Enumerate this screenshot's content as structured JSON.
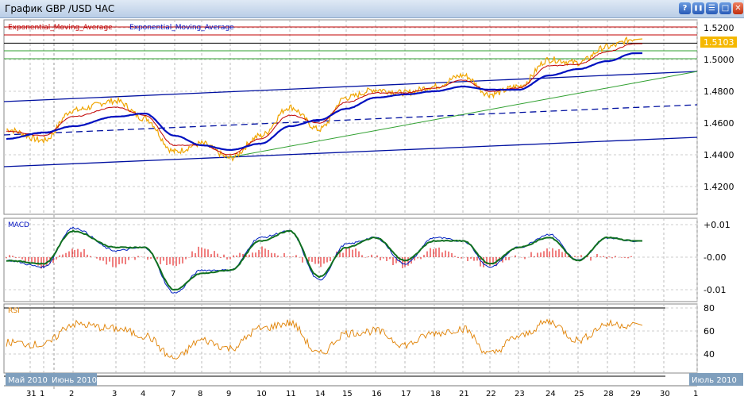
{
  "window": {
    "title": "График GBP /USD  ЧАС",
    "buttons": [
      "?",
      "❚❚",
      "☰",
      "□",
      "✕"
    ]
  },
  "colors": {
    "price": "#f0a500",
    "ema_fast": "#c00000",
    "ema_slow": "#0010c0",
    "macd": "#0020c0",
    "signal": "#107020",
    "hist": "#e00000",
    "rsi": "#e08000"
  },
  "chart_data": [
    {
      "type": "line",
      "title": "GBP/USD",
      "legend": [
        "Exponential_Moving_Average",
        "Exponential_Moving_Average"
      ],
      "ylim": [
        1.41,
        1.525
      ],
      "yticks": [
        "1.5200",
        "1.5000",
        "1.4800",
        "1.4600",
        "1.4400",
        "1.4200"
      ],
      "ytick_values": [
        1.52,
        1.5,
        1.48,
        1.46,
        1.44,
        1.42
      ],
      "last_price": "1.5103",
      "categories": [
        "31",
        "1",
        "2",
        "3",
        "4",
        "7",
        "8",
        "9",
        "10",
        "11",
        "14",
        "15",
        "16",
        "17",
        "18",
        "21",
        "22",
        "23",
        "24",
        "25",
        "28",
        "29"
      ],
      "series": [
        {
          "name": "price",
          "values": [
            1.456,
            1.449,
            1.468,
            1.474,
            1.463,
            1.442,
            1.447,
            1.438,
            1.452,
            1.47,
            1.456,
            1.476,
            1.481,
            1.479,
            1.483,
            1.49,
            1.478,
            1.483,
            1.5,
            1.498,
            1.508,
            1.513
          ]
        },
        {
          "name": "ema_fast",
          "values": [
            1.455,
            1.452,
            1.464,
            1.47,
            1.465,
            1.446,
            1.446,
            1.44,
            1.45,
            1.465,
            1.46,
            1.473,
            1.479,
            1.479,
            1.482,
            1.487,
            1.48,
            1.482,
            1.496,
            1.497,
            1.505,
            1.51
          ]
        },
        {
          "name": "ema_slow",
          "values": [
            1.45,
            1.454,
            1.458,
            1.464,
            1.466,
            1.452,
            1.446,
            1.443,
            1.447,
            1.458,
            1.462,
            1.469,
            1.476,
            1.478,
            1.48,
            1.483,
            1.481,
            1.481,
            1.49,
            1.494,
            1.499,
            1.504
          ]
        }
      ],
      "hlines": [
        1.5205,
        1.5155,
        1.5103,
        1.5055,
        1.5005
      ]
    },
    {
      "type": "line",
      "title": "MACD",
      "yticks": [
        "+0.01",
        "-0.00",
        "-0.01"
      ],
      "ytick_values": [
        0.01,
        0,
        -0.01
      ],
      "ylim": [
        -0.012,
        0.012
      ],
      "categories": [
        "31",
        "1",
        "2",
        "3",
        "4",
        "7",
        "8",
        "9",
        "10",
        "11",
        "14",
        "15",
        "16",
        "17",
        "18",
        "21",
        "22",
        "23",
        "24",
        "25",
        "28",
        "29"
      ],
      "series": [
        {
          "name": "macd",
          "values": [
            -0.001,
            -0.003,
            0.009,
            0.002,
            0.003,
            -0.011,
            -0.004,
            -0.004,
            0.006,
            0.008,
            -0.007,
            0.004,
            0.006,
            -0.002,
            0.006,
            0.005,
            -0.003,
            0.003,
            0.007,
            -0.001,
            0.006,
            0.005
          ]
        },
        {
          "name": "signal",
          "values": [
            -0.001,
            -0.002,
            0.008,
            0.003,
            0.003,
            -0.01,
            -0.005,
            -0.004,
            0.005,
            0.008,
            -0.006,
            0.003,
            0.006,
            -0.001,
            0.005,
            0.005,
            -0.002,
            0.003,
            0.006,
            -0.001,
            0.006,
            0.005
          ]
        }
      ]
    },
    {
      "type": "line",
      "title": "RSI",
      "yticks": [
        "80",
        "60",
        "40"
      ],
      "ytick_values": [
        80,
        60,
        40
      ],
      "ylim": [
        20,
        85
      ],
      "categories": [
        "31",
        "1",
        "2",
        "3",
        "4",
        "7",
        "8",
        "9",
        "10",
        "11",
        "14",
        "15",
        "16",
        "17",
        "18",
        "21",
        "22",
        "23",
        "24",
        "25",
        "28",
        "29"
      ],
      "series": [
        {
          "name": "rsi",
          "values": [
            50,
            48,
            66,
            62,
            56,
            36,
            52,
            45,
            62,
            67,
            40,
            58,
            60,
            48,
            58,
            62,
            40,
            55,
            68,
            52,
            66,
            65
          ]
        }
      ]
    }
  ],
  "xaxis": {
    "months": [
      "Май 2010",
      "Июнь 2010",
      "Июль 2010"
    ],
    "days": [
      "31",
      "1",
      "2",
      "3",
      "4",
      "7",
      "8",
      "9",
      "10",
      "11",
      "14",
      "15",
      "16",
      "17",
      "18",
      "21",
      "22",
      "23",
      "24",
      "25",
      "28",
      "29",
      "30",
      "1"
    ]
  }
}
